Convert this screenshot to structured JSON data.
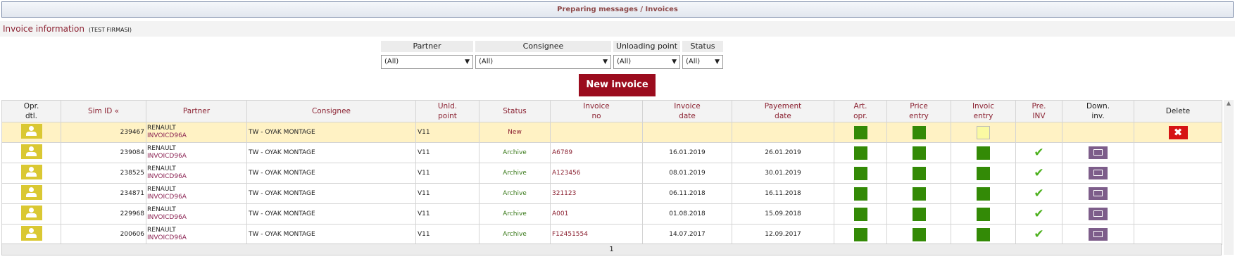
{
  "header": {
    "title": "Preparing messages / Invoices"
  },
  "info": {
    "title": "Invoice information",
    "company": "(TEST FIRMASI)"
  },
  "filters": [
    {
      "label": "Partner",
      "value": "(All)"
    },
    {
      "label": "Consignee",
      "value": "(All)"
    },
    {
      "label": "Unloading point",
      "value": "(All)"
    },
    {
      "label": "Status",
      "value": "(All)"
    }
  ],
  "new_invoice_label": "New invoice",
  "columns": {
    "opr": [
      "Opr.",
      "dtl."
    ],
    "sim_id": "Sim ID «",
    "partner": "Partner",
    "consignee": "Consignee",
    "unld": [
      "Unld.",
      "point"
    ],
    "status": "Status",
    "invoice_no": [
      "Invoice",
      "no"
    ],
    "invoice_date": [
      "Invoice",
      "date"
    ],
    "payment_date": [
      "Payement",
      "date"
    ],
    "art": [
      "Art.",
      "opr."
    ],
    "price": [
      "Price",
      "entry"
    ],
    "invoic": [
      "Invoic",
      "entry"
    ],
    "pre": [
      "Pre.",
      "INV"
    ],
    "down": [
      "Down.",
      "inv."
    ],
    "delete": "Delete"
  },
  "rows": [
    {
      "sim_id": "239467",
      "partner": "RENAULT",
      "partner_code": "INVOICD96A",
      "consignee": "TW - OYAK MONTAGE",
      "unld": "V11",
      "status": "New",
      "invoice_no": "",
      "invoice_date": "",
      "payment_date": ""
    },
    {
      "sim_id": "239084",
      "partner": "RENAULT",
      "partner_code": "INVOICD96A",
      "consignee": "TW - OYAK MONTAGE",
      "unld": "V11",
      "status": "Archive",
      "invoice_no": "A6789",
      "invoice_date": "16.01.2019",
      "payment_date": "26.01.2019"
    },
    {
      "sim_id": "238525",
      "partner": "RENAULT",
      "partner_code": "INVOICD96A",
      "consignee": "TW - OYAK MONTAGE",
      "unld": "V11",
      "status": "Archive",
      "invoice_no": "A123456",
      "invoice_date": "08.01.2019",
      "payment_date": "30.01.2019"
    },
    {
      "sim_id": "234871",
      "partner": "RENAULT",
      "partner_code": "INVOICD96A",
      "consignee": "TW - OYAK MONTAGE",
      "unld": "V11",
      "status": "Archive",
      "invoice_no": "321123",
      "invoice_date": "06.11.2018",
      "payment_date": "16.11.2018"
    },
    {
      "sim_id": "229968",
      "partner": "RENAULT",
      "partner_code": "INVOICD96A",
      "consignee": "TW - OYAK MONTAGE",
      "unld": "V11",
      "status": "Archive",
      "invoice_no": "A001",
      "invoice_date": "01.08.2018",
      "payment_date": "15.09.2018"
    },
    {
      "sim_id": "200606",
      "partner": "RENAULT",
      "partner_code": "INVOICD96A",
      "consignee": "TW - OYAK MONTAGE",
      "unld": "V11",
      "status": "Archive",
      "invoice_no": "F12451554",
      "invoice_date": "14.07.2017",
      "payment_date": "12.09.2017"
    }
  ],
  "pager": {
    "page": "1"
  },
  "colors": {
    "accent": "#8b2232",
    "button": "#9b0c1e",
    "green": "#338a06",
    "archive": "#3b7a1c",
    "selected_row": "#fff2c4"
  },
  "icons": {
    "opr": "user-card-icon",
    "done": "check-icon",
    "download": "download-card-icon",
    "delete": "close-icon"
  }
}
